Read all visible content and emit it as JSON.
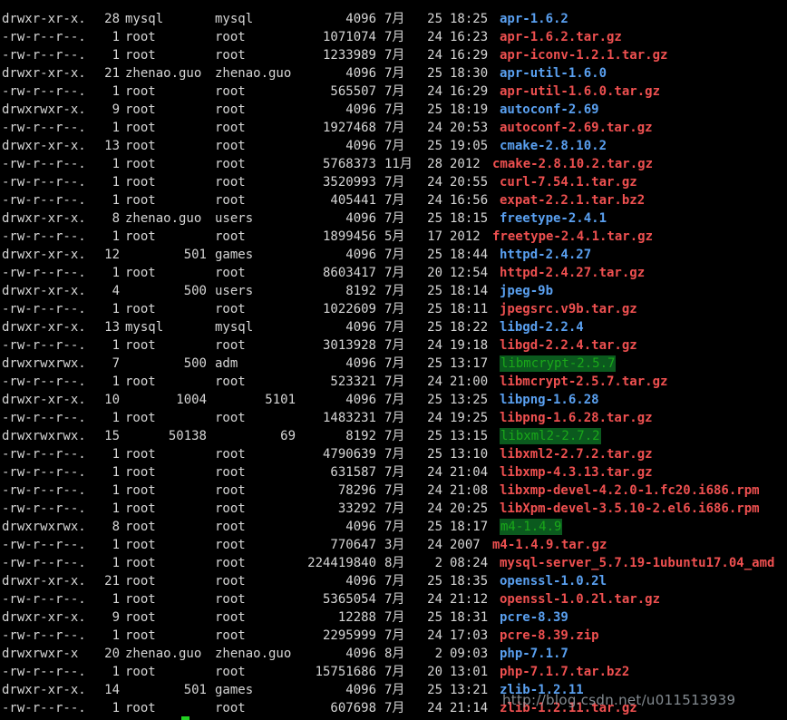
{
  "listing": [
    {
      "perm": "drwxr-xr-x.",
      "links": "28",
      "owner": "mysql",
      "group": "mysql",
      "size": "4096",
      "month": "7月",
      "day": "25",
      "time": "18:25",
      "name": "apr-1.6.2",
      "kind": "dir"
    },
    {
      "perm": "-rw-r--r--.",
      "links": "1",
      "owner": "root",
      "group": "root",
      "size": "1071074",
      "month": "7月",
      "day": "24",
      "time": "16:23",
      "name": "apr-1.6.2.tar.gz",
      "kind": "arc"
    },
    {
      "perm": "-rw-r--r--.",
      "links": "1",
      "owner": "root",
      "group": "root",
      "size": "1233989",
      "month": "7月",
      "day": "24",
      "time": "16:29",
      "name": "apr-iconv-1.2.1.tar.gz",
      "kind": "arc"
    },
    {
      "perm": "drwxr-xr-x.",
      "links": "21",
      "owner": "zhenao.guo",
      "group": "zhenao.guo",
      "size": "4096",
      "month": "7月",
      "day": "25",
      "time": "18:30",
      "name": "apr-util-1.6.0",
      "kind": "dir"
    },
    {
      "perm": "-rw-r--r--.",
      "links": "1",
      "owner": "root",
      "group": "root",
      "size": "565507",
      "month": "7月",
      "day": "24",
      "time": "16:29",
      "name": "apr-util-1.6.0.tar.gz",
      "kind": "arc"
    },
    {
      "perm": "drwxrwxr-x.",
      "links": "9",
      "owner": "root",
      "group": "root",
      "size": "4096",
      "month": "7月",
      "day": "25",
      "time": "18:19",
      "name": "autoconf-2.69",
      "kind": "dir"
    },
    {
      "perm": "-rw-r--r--.",
      "links": "1",
      "owner": "root",
      "group": "root",
      "size": "1927468",
      "month": "7月",
      "day": "24",
      "time": "20:53",
      "name": "autoconf-2.69.tar.gz",
      "kind": "arc"
    },
    {
      "perm": "drwxr-xr-x.",
      "links": "13",
      "owner": "root",
      "group": "root",
      "size": "4096",
      "month": "7月",
      "day": "25",
      "time": "19:05",
      "name": "cmake-2.8.10.2",
      "kind": "dir"
    },
    {
      "perm": "-rw-r--r--.",
      "links": "1",
      "owner": "root",
      "group": "root",
      "size": "5768373",
      "month": "11月",
      "day": "28",
      "time": "2012",
      "name": "cmake-2.8.10.2.tar.gz",
      "kind": "arc",
      "year": true
    },
    {
      "perm": "-rw-r--r--.",
      "links": "1",
      "owner": "root",
      "group": "root",
      "size": "3520993",
      "month": "7月",
      "day": "24",
      "time": "20:55",
      "name": "curl-7.54.1.tar.gz",
      "kind": "arc"
    },
    {
      "perm": "-rw-r--r--.",
      "links": "1",
      "owner": "root",
      "group": "root",
      "size": "405441",
      "month": "7月",
      "day": "24",
      "time": "16:56",
      "name": "expat-2.2.1.tar.bz2",
      "kind": "arc"
    },
    {
      "perm": "drwxr-xr-x.",
      "links": "8",
      "owner": "zhenao.guo",
      "group": "users",
      "size": "4096",
      "month": "7月",
      "day": "25",
      "time": "18:15",
      "name": "freetype-2.4.1",
      "kind": "dir"
    },
    {
      "perm": "-rw-r--r--.",
      "links": "1",
      "owner": "root",
      "group": "root",
      "size": "1899456",
      "month": "5月",
      "day": "17",
      "time": "2012",
      "name": "freetype-2.4.1.tar.gz",
      "kind": "arc",
      "year": true
    },
    {
      "perm": "drwxr-xr-x.",
      "links": "12",
      "owner": "501",
      "group": "games",
      "size": "4096",
      "month": "7月",
      "day": "25",
      "time": "18:44",
      "name": "httpd-2.4.27",
      "kind": "dir",
      "ownerNum": true
    },
    {
      "perm": "-rw-r--r--.",
      "links": "1",
      "owner": "root",
      "group": "root",
      "size": "8603417",
      "month": "7月",
      "day": "20",
      "time": "12:54",
      "name": "httpd-2.4.27.tar.gz",
      "kind": "arc"
    },
    {
      "perm": "drwxr-xr-x.",
      "links": "4",
      "owner": "500",
      "group": "users",
      "size": "8192",
      "month": "7月",
      "day": "25",
      "time": "18:14",
      "name": "jpeg-9b",
      "kind": "dir",
      "ownerNum": true
    },
    {
      "perm": "-rw-r--r--.",
      "links": "1",
      "owner": "root",
      "group": "root",
      "size": "1022609",
      "month": "7月",
      "day": "25",
      "time": "18:11",
      "name": "jpegsrc.v9b.tar.gz",
      "kind": "arc"
    },
    {
      "perm": "drwxr-xr-x.",
      "links": "13",
      "owner": "mysql",
      "group": "mysql",
      "size": "4096",
      "month": "7月",
      "day": "25",
      "time": "18:22",
      "name": "libgd-2.2.4",
      "kind": "dir"
    },
    {
      "perm": "-rw-r--r--.",
      "links": "1",
      "owner": "root",
      "group": "root",
      "size": "3013928",
      "month": "7月",
      "day": "24",
      "time": "19:18",
      "name": "libgd-2.2.4.tar.gz",
      "kind": "arc"
    },
    {
      "perm": "drwxrwxrwx.",
      "links": "7",
      "owner": "500",
      "group": "adm",
      "size": "4096",
      "month": "7月",
      "day": "25",
      "time": "13:17",
      "name": "libmcrypt-2.5.7",
      "kind": "sticky",
      "ownerNum": true
    },
    {
      "perm": "-rw-r--r--.",
      "links": "1",
      "owner": "root",
      "group": "root",
      "size": "523321",
      "month": "7月",
      "day": "24",
      "time": "21:00",
      "name": "libmcrypt-2.5.7.tar.gz",
      "kind": "arc"
    },
    {
      "perm": "drwxr-xr-x.",
      "links": "10",
      "owner": "1004",
      "group": "5101",
      "size": "4096",
      "month": "7月",
      "day": "25",
      "time": "13:25",
      "name": "libpng-1.6.28",
      "kind": "dir",
      "ownerNum": true,
      "groupNum": true
    },
    {
      "perm": "-rw-r--r--.",
      "links": "1",
      "owner": "root",
      "group": "root",
      "size": "1483231",
      "month": "7月",
      "day": "24",
      "time": "19:25",
      "name": "libpng-1.6.28.tar.gz",
      "kind": "arc"
    },
    {
      "perm": "drwxrwxrwx.",
      "links": "15",
      "owner": "50138",
      "group": "69",
      "size": "8192",
      "month": "7月",
      "day": "25",
      "time": "13:15",
      "name": "libxml2-2.7.2",
      "kind": "sticky",
      "ownerNum": true,
      "groupNum": true
    },
    {
      "perm": "-rw-r--r--.",
      "links": "1",
      "owner": "root",
      "group": "root",
      "size": "4790639",
      "month": "7月",
      "day": "25",
      "time": "13:10",
      "name": "libxml2-2.7.2.tar.gz",
      "kind": "arc"
    },
    {
      "perm": "-rw-r--r--.",
      "links": "1",
      "owner": "root",
      "group": "root",
      "size": "631587",
      "month": "7月",
      "day": "24",
      "time": "21:04",
      "name": "libxmp-4.3.13.tar.gz",
      "kind": "arc"
    },
    {
      "perm": "-rw-r--r--.",
      "links": "1",
      "owner": "root",
      "group": "root",
      "size": "78296",
      "month": "7月",
      "day": "24",
      "time": "21:08",
      "name": "libxmp-devel-4.2.0-1.fc20.i686.rpm",
      "kind": "arc"
    },
    {
      "perm": "-rw-r--r--.",
      "links": "1",
      "owner": "root",
      "group": "root",
      "size": "33292",
      "month": "7月",
      "day": "24",
      "time": "20:25",
      "name": "libXpm-devel-3.5.10-2.el6.i686.rpm",
      "kind": "arc"
    },
    {
      "perm": "drwxrwxrwx.",
      "links": "8",
      "owner": "root",
      "group": "root",
      "size": "4096",
      "month": "7月",
      "day": "25",
      "time": "18:17",
      "name": "m4-1.4.9",
      "kind": "sticky"
    },
    {
      "perm": "-rw-r--r--.",
      "links": "1",
      "owner": "root",
      "group": "root",
      "size": "770647",
      "month": "3月",
      "day": "24",
      "time": "2007",
      "name": "m4-1.4.9.tar.gz",
      "kind": "arc",
      "year": true
    },
    {
      "perm": "-rw-r--r--.",
      "links": "1",
      "owner": "root",
      "group": "root",
      "size": "224419840",
      "month": "8月",
      "day": "2",
      "time": "08:24",
      "name": "mysql-server_5.7.19-1ubuntu17.04_amd",
      "kind": "arc"
    },
    {
      "perm": "drwxr-xr-x.",
      "links": "21",
      "owner": "root",
      "group": "root",
      "size": "4096",
      "month": "7月",
      "day": "25",
      "time": "18:35",
      "name": "openssl-1.0.2l",
      "kind": "dir"
    },
    {
      "perm": "-rw-r--r--.",
      "links": "1",
      "owner": "root",
      "group": "root",
      "size": "5365054",
      "month": "7月",
      "day": "24",
      "time": "21:12",
      "name": "openssl-1.0.2l.tar.gz",
      "kind": "arc"
    },
    {
      "perm": "drwxr-xr-x.",
      "links": "9",
      "owner": "root",
      "group": "root",
      "size": "12288",
      "month": "7月",
      "day": "25",
      "time": "18:31",
      "name": "pcre-8.39",
      "kind": "dir"
    },
    {
      "perm": "-rw-r--r--.",
      "links": "1",
      "owner": "root",
      "group": "root",
      "size": "2295999",
      "month": "7月",
      "day": "24",
      "time": "17:03",
      "name": "pcre-8.39.zip",
      "kind": "arc"
    },
    {
      "perm": "drwxrwxr-x",
      "links": "20",
      "owner": "zhenao.guo",
      "group": "zhenao.guo",
      "size": "4096",
      "month": "8月",
      "day": "2",
      "time": "09:03",
      "name": "php-7.1.7",
      "kind": "dir"
    },
    {
      "perm": "-rw-r--r--.",
      "links": "1",
      "owner": "root",
      "group": "root",
      "size": "15751686",
      "month": "7月",
      "day": "20",
      "time": "13:01",
      "name": "php-7.1.7.tar.bz2",
      "kind": "arc"
    },
    {
      "perm": "drwxr-xr-x.",
      "links": "14",
      "owner": "501",
      "group": "games",
      "size": "4096",
      "month": "7月",
      "day": "25",
      "time": "13:21",
      "name": "zlib-1.2.11",
      "kind": "dir",
      "ownerNum": true
    },
    {
      "perm": "-rw-r--r--.",
      "links": "1",
      "owner": "root",
      "group": "root",
      "size": "607698",
      "month": "7月",
      "day": "24",
      "time": "21:14",
      "name": "zlib-1.2.11.tar.gz",
      "kind": "arc"
    }
  ],
  "watermark": "http://blog.csdn.net/u011513939",
  "colors": {
    "background": "#000000",
    "text": "#d6d6d6",
    "directory": "#5aa0f0",
    "archive": "#ee5050",
    "sticky_text": "#1aa81a",
    "sticky_bg": "#0b5a1e",
    "cursor": "#22d022"
  }
}
